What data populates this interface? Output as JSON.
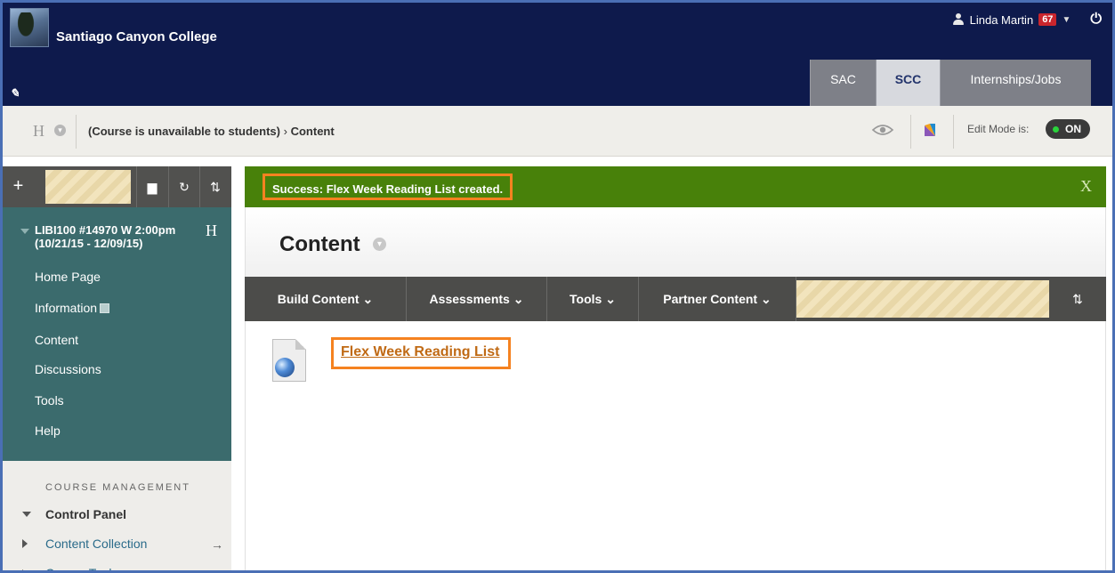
{
  "header": {
    "college_name": "Santiago Canyon College",
    "user_name": "Linda Martin",
    "notification_count": "67",
    "tabs": [
      {
        "label": "SAC"
      },
      {
        "label": "SCC"
      },
      {
        "label": "Internships/Jobs"
      }
    ]
  },
  "breadcrumb": {
    "h_glyph": "H",
    "status": "(Course is unavailable to students)",
    "separator": "›",
    "current": "Content",
    "edit_mode_label": "Edit Mode is:",
    "edit_mode_value": "ON"
  },
  "sidebar": {
    "course_title": "LIBI100 #14970 W 2:00pm (10/21/15 - 12/09/15)",
    "course_h": "H",
    "menu_items": [
      {
        "label": "Home Page"
      },
      {
        "label": "Information"
      },
      {
        "label": "Content"
      },
      {
        "label": "Discussions"
      },
      {
        "label": "Tools"
      },
      {
        "label": "Help"
      }
    ],
    "management_label": "COURSE MANAGEMENT",
    "control_panel": "Control Panel",
    "content_collection": "Content Collection",
    "course_tools": "Course Tools"
  },
  "main": {
    "success_message": "Success: Flex Week Reading List created.",
    "close_label": "X",
    "page_title": "Content",
    "actions": [
      {
        "label": "Build Content"
      },
      {
        "label": "Assessments"
      },
      {
        "label": "Tools"
      },
      {
        "label": "Partner Content"
      }
    ],
    "items": [
      {
        "title": "Flex Week Reading List"
      }
    ]
  },
  "colors": {
    "header_bg": "#0e1a4c",
    "sidebar_bg": "#3b6b6d",
    "success_bg": "#48810a",
    "highlight": "#f58220",
    "action_bar_bg": "#4c4c4a"
  }
}
